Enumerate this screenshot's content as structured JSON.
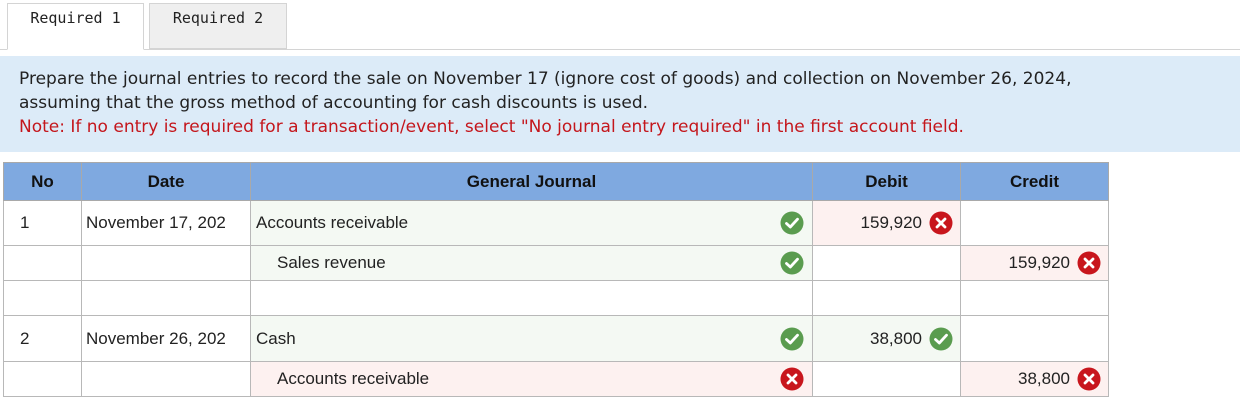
{
  "tabs": [
    {
      "label": "Required 1",
      "active": true
    },
    {
      "label": "Required 2",
      "active": false
    }
  ],
  "instructions": {
    "line1": "Prepare the journal entries to record the sale on November 17 (ignore cost of goods) and collection on November 26, 2024,",
    "line2": "assuming that the gross method of accounting for cash discounts is used.",
    "note": "Note: If no entry is required for a transaction/event, select \"No journal entry required\" in the first account field."
  },
  "table": {
    "headers": {
      "no": "No",
      "date": "Date",
      "journal": "General Journal",
      "debit": "Debit",
      "credit": "Credit"
    },
    "rows": [
      {
        "no": "1",
        "date": "November 17, 202",
        "account": "Accounts receivable",
        "indent": false,
        "account_status": "correct",
        "debit": "159,920",
        "debit_status": "incorrect",
        "credit": "",
        "credit_status": ""
      },
      {
        "no": "",
        "date": "",
        "account": "Sales revenue",
        "indent": true,
        "account_status": "correct",
        "debit": "",
        "debit_status": "",
        "credit": "159,920",
        "credit_status": "incorrect"
      },
      {
        "no": "",
        "date": "",
        "account": "",
        "indent": false,
        "account_status": "",
        "debit": "",
        "debit_status": "",
        "credit": "",
        "credit_status": ""
      },
      {
        "no": "2",
        "date": "November 26, 202",
        "account": "Cash",
        "indent": false,
        "account_status": "correct",
        "debit": "38,800",
        "debit_status": "correct",
        "credit": "",
        "credit_status": ""
      },
      {
        "no": "",
        "date": "",
        "account": "Accounts receivable",
        "indent": true,
        "account_status": "incorrect",
        "debit": "",
        "debit_status": "",
        "credit": "38,800",
        "credit_status": "incorrect"
      }
    ]
  },
  "icons": {
    "correct": "check-circle-icon",
    "incorrect": "x-circle-icon"
  },
  "colors": {
    "correct": "#5a9c4f",
    "incorrect": "#c8161d",
    "header": "#7fa9e0",
    "instructions_bg": "#dcebf8",
    "note": "#c4161c"
  }
}
